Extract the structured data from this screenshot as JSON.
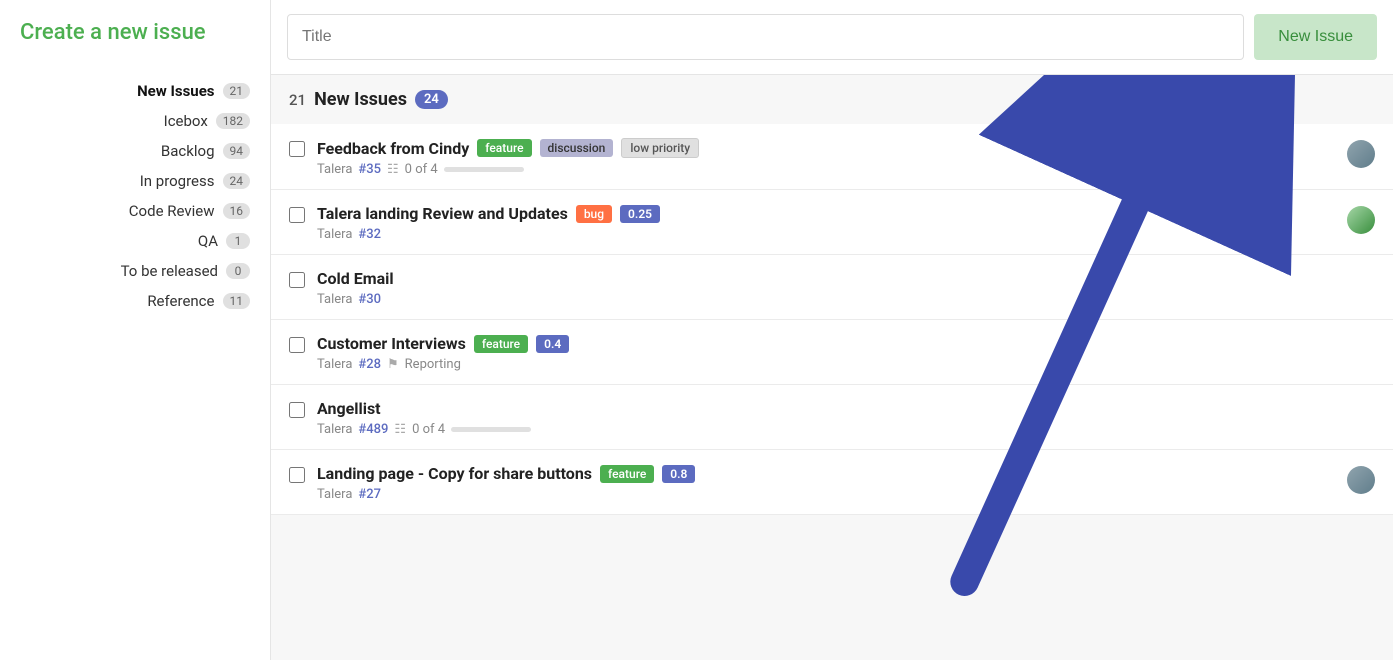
{
  "sidebar": {
    "create_label": "Create a new issue",
    "items": [
      {
        "id": "new-issues",
        "label": "New Issues",
        "count": "21",
        "active": true
      },
      {
        "id": "icebox",
        "label": "Icebox",
        "count": "182",
        "active": false
      },
      {
        "id": "backlog",
        "label": "Backlog",
        "count": "94",
        "active": false
      },
      {
        "id": "in-progress",
        "label": "In progress",
        "count": "24",
        "active": false
      },
      {
        "id": "code-review",
        "label": "Code Review",
        "count": "16",
        "active": false
      },
      {
        "id": "qa",
        "label": "QA",
        "count": "1",
        "active": false
      },
      {
        "id": "to-be-released",
        "label": "To be released",
        "count": "0",
        "active": false
      },
      {
        "id": "reference",
        "label": "Reference",
        "count": "11",
        "active": false
      }
    ]
  },
  "topbar": {
    "title_placeholder": "Title",
    "new_issue_label": "New Issue"
  },
  "issues_list": {
    "header_count": "21",
    "header_title": "New Issues",
    "header_badge": "24",
    "issues": [
      {
        "id": 1,
        "title": "Feedback from Cindy",
        "project": "Talera",
        "number": "#35",
        "tags": [
          "feature",
          "discussion",
          "low priority"
        ],
        "meta_type": "checklist",
        "meta_text": "0 of 4",
        "has_avatar": true,
        "avatar_type": "1"
      },
      {
        "id": 2,
        "title": "Talera landing Review and Updates",
        "project": "Talera",
        "number": "#32",
        "tags": [
          "bug"
        ],
        "points": "0.25",
        "has_avatar": true,
        "avatar_type": "2"
      },
      {
        "id": 3,
        "title": "Cold Email",
        "project": "Talera",
        "number": "#30",
        "tags": [],
        "has_avatar": false
      },
      {
        "id": 4,
        "title": "Customer Interviews",
        "project": "Talera",
        "number": "#28",
        "tags": [
          "feature"
        ],
        "points": "0.4",
        "meta_type": "milestone",
        "meta_text": "Reporting",
        "has_avatar": false
      },
      {
        "id": 5,
        "title": "Angellist",
        "project": "Talera",
        "number": "#489",
        "tags": [],
        "meta_type": "checklist",
        "meta_text": "0 of 4",
        "has_avatar": false
      },
      {
        "id": 6,
        "title": "Landing page - Copy for share buttons",
        "project": "Talera",
        "number": "#27",
        "tags": [
          "feature"
        ],
        "points": "0.8",
        "has_avatar": true,
        "avatar_type": "1"
      }
    ]
  },
  "colors": {
    "green": "#4caf50",
    "purple": "#5c6bc0",
    "orange": "#ff7043",
    "grey": "#e0e0e0"
  }
}
